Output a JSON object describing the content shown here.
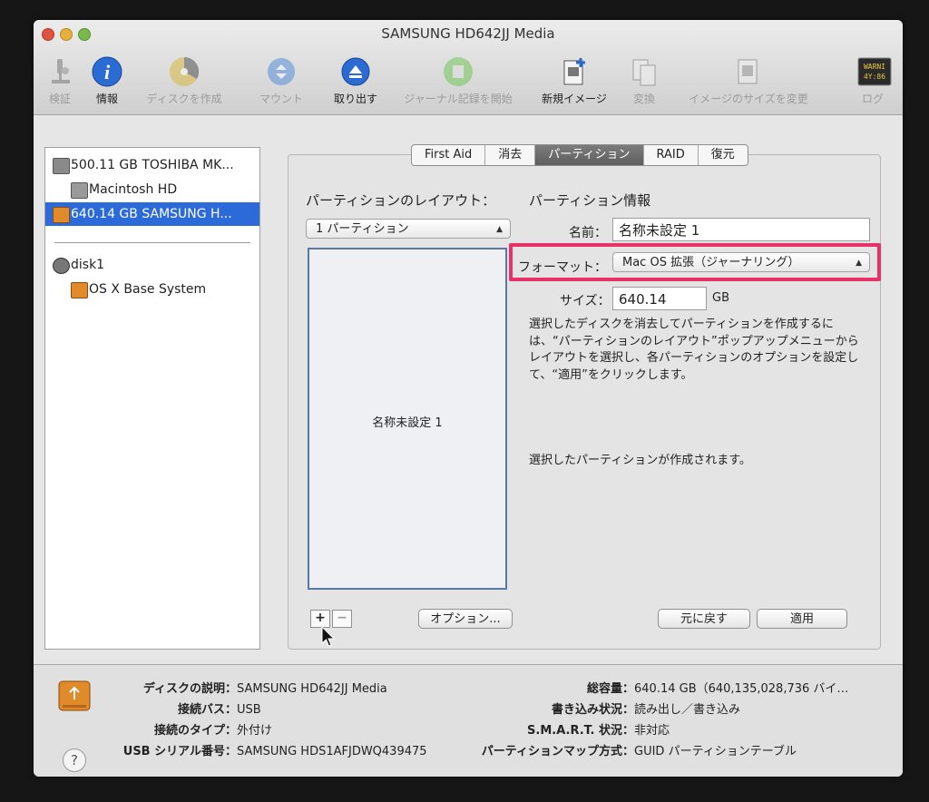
{
  "window": {
    "title": "SAMSUNG HD642JJ Media"
  },
  "toolbar": [
    {
      "label": "検証",
      "icon": "microscope-icon",
      "enabled": false
    },
    {
      "label": "情報",
      "icon": "info-icon",
      "enabled": true
    },
    {
      "label": "ディスクを作成",
      "icon": "burn-icon",
      "enabled": false
    },
    {
      "label": "マウント",
      "icon": "mount-icon",
      "enabled": false
    },
    {
      "label": "取り出す",
      "icon": "eject-icon",
      "enabled": true
    },
    {
      "label": "ジャーナル記録を開始",
      "icon": "journal-icon",
      "enabled": false
    },
    {
      "label": "新規イメージ",
      "icon": "new-image-icon",
      "enabled": true
    },
    {
      "label": "変換",
      "icon": "convert-icon",
      "enabled": false
    },
    {
      "label": "イメージのサイズを変更",
      "icon": "resize-image-icon",
      "enabled": false
    },
    {
      "label": "ログ",
      "icon": "log-icon",
      "enabled": false
    }
  ],
  "log_icon_text": "WARNI\n4Y:86",
  "sidebar": {
    "items": [
      {
        "label": "500.11 GB TOSHIBA MK...",
        "level": 0,
        "icon": "hard-drive-icon",
        "selected": false
      },
      {
        "label": "Macintosh HD",
        "level": 1,
        "icon": "volume-icon",
        "selected": false
      },
      {
        "label": "640.14 GB SAMSUNG H...",
        "level": 0,
        "icon": "usb-drive-icon",
        "selected": true
      },
      {
        "label": "disk1",
        "level": 0,
        "icon": "disc-icon",
        "selected": false
      },
      {
        "label": "OS X Base System",
        "level": 1,
        "icon": "volume-icon",
        "selected": false
      }
    ]
  },
  "tabs": [
    {
      "label": "First Aid",
      "active": false
    },
    {
      "label": "消去",
      "active": false
    },
    {
      "label": "パーティション",
      "active": true
    },
    {
      "label": "RAID",
      "active": false
    },
    {
      "label": "復元",
      "active": false
    }
  ],
  "partition": {
    "layout_heading": "パーティションのレイアウト：",
    "layout_value": "1 パーティション",
    "info_heading": "パーティション情報",
    "name_label": "名前：",
    "name_value": "名称未設定 1",
    "format_label": "フォーマット：",
    "format_value": "Mac OS 拡張（ジャーナリング）",
    "size_label": "サイズ：",
    "size_value": "640.14",
    "size_unit": "GB",
    "map_partition_name": "名称未設定 1",
    "description": "選択したディスクを消去してパーティションを作成するには、“パーティションのレイアウト”ポップアップメニューからレイアウトを選択し、各パーティションのオプションを設定して、“適用”をクリックします。",
    "status": "選択したパーティションが作成されます。",
    "add_label": "+",
    "remove_label": "−",
    "options_label": "オプション...",
    "revert_label": "元に戻す",
    "apply_label": "適用"
  },
  "footer": {
    "left": [
      {
        "key": "ディスクの説明：",
        "value": "SAMSUNG HD642JJ Media"
      },
      {
        "key": "接続バス：",
        "value": "USB"
      },
      {
        "key": "接続のタイプ：",
        "value": "外付け"
      },
      {
        "key": "USB シリアル番号：",
        "value": "SAMSUNG HDS1AFJDWQ439475"
      }
    ],
    "right": [
      {
        "key": "総容量：",
        "value": "640.14 GB（640,135,028,736 バイ…"
      },
      {
        "key": "書き込み状況：",
        "value": "読み出し／書き込み"
      },
      {
        "key": "S.M.A.R.T. 状況：",
        "value": "非対応"
      },
      {
        "key": "パーティションマップ方式：",
        "value": "GUID パーティションテーブル"
      }
    ],
    "help_label": "?"
  },
  "colors": {
    "selection": "#2b6ad8",
    "highlight_box": "#e8306a",
    "info_icon": "#2a6cd4"
  }
}
